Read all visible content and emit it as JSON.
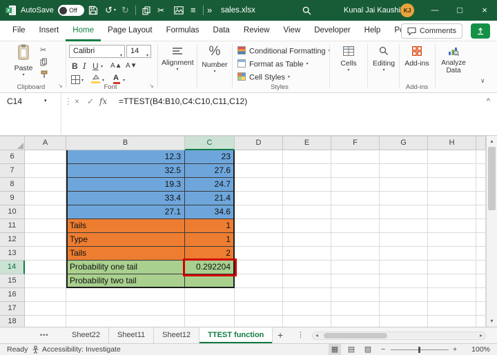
{
  "colors": {
    "titlebar_green": "#185C37",
    "excel_accent_green": "#107C41",
    "cell_fill_blue": "#6EA6DB",
    "cell_fill_orange": "#ED7D31",
    "cell_fill_green": "#A9D08E",
    "selection_border_red": "#D00000",
    "avatar_gold": "#E8A33D",
    "addins_icon_orange": "#D83B01",
    "share_button_green": "#159147"
  },
  "title_bar": {
    "autosave_label": "AutoSave",
    "autosave_state": "Off",
    "filename": "sales.xlsx",
    "user_name": "Kunal Jai Kaushik",
    "user_initials": "KJ"
  },
  "menu": {
    "tabs": [
      {
        "label": "File"
      },
      {
        "label": "Insert"
      },
      {
        "label": "Home",
        "active": true
      },
      {
        "label": "Page Layout"
      },
      {
        "label": "Formulas"
      },
      {
        "label": "Data"
      },
      {
        "label": "Review"
      },
      {
        "label": "View"
      },
      {
        "label": "Developer"
      },
      {
        "label": "Help"
      },
      {
        "label": "Power Pivot"
      }
    ],
    "comments_label": "Comments"
  },
  "ribbon": {
    "paste_label": "Paste",
    "clipboard_group_label": "Clipboard",
    "font_name": "Calibri",
    "font_size": "14",
    "font_group_label": "Font",
    "alignment_label": "Alignment",
    "number_label": "Number",
    "styles_items": [
      "Conditional Formatting",
      "Format as Table",
      "Cell Styles"
    ],
    "styles_group_label": "Styles",
    "cells_label": "Cells",
    "editing_label": "Editing",
    "addins_label": "Add-ins",
    "addins_group_label": "Add-ins",
    "analyze_data_label": "Analyze Data"
  },
  "formula_bar": {
    "name_box": "C14",
    "formula": "=TTEST(B4:B10,C4:C10,C11,C12)"
  },
  "sheet": {
    "columns": [
      "A",
      "B",
      "C",
      "D",
      "E",
      "F",
      "G",
      "H"
    ],
    "selected_column": "C",
    "selected_row": 14,
    "selected_cell": "C14",
    "rows": [
      {
        "row": 6,
        "fill": "blue",
        "cells": {
          "B": "12.3",
          "C": "23"
        }
      },
      {
        "row": 7,
        "fill": "blue",
        "cells": {
          "B": "32.5",
          "C": "27.6"
        }
      },
      {
        "row": 8,
        "fill": "blue",
        "cells": {
          "B": "19.3",
          "C": "24.7"
        }
      },
      {
        "row": 9,
        "fill": "blue",
        "cells": {
          "B": "33.4",
          "C": "21.4"
        }
      },
      {
        "row": 10,
        "fill": "blue",
        "cells": {
          "B": "27.1",
          "C": "34.6"
        }
      },
      {
        "row": 11,
        "fill": "orange",
        "cells": {
          "B": "Tails",
          "C": "1"
        }
      },
      {
        "row": 12,
        "fill": "orange",
        "cells": {
          "B": "Type",
          "C": "1"
        }
      },
      {
        "row": 13,
        "fill": "orange",
        "cells": {
          "B": "Tails",
          "C": "2"
        }
      },
      {
        "row": 14,
        "fill": "green",
        "cells": {
          "B": "Probability one tail",
          "C": "0.292204"
        }
      },
      {
        "row": 15,
        "fill": "green",
        "cells": {
          "B": "Probability two tail",
          "C": ""
        }
      },
      {
        "row": 16,
        "cells": {}
      },
      {
        "row": 17,
        "cells": {}
      },
      {
        "row": 18,
        "cells": {}
      }
    ]
  },
  "sheet_tabs": {
    "tabs": [
      {
        "label": "Sheet22"
      },
      {
        "label": "Sheet11"
      },
      {
        "label": "Sheet12"
      },
      {
        "label": "TTEST function",
        "active": true
      }
    ]
  },
  "status_bar": {
    "mode": "Ready",
    "accessibility": "Accessibility: Investigate",
    "zoom": "100%"
  },
  "icons": {
    "dropdown": "▾",
    "undo": "↺",
    "redo": "↻",
    "cut": "✂",
    "list": "≡",
    "more": "»",
    "close": "×",
    "check": "✓",
    "fx": "fx",
    "chevron_up": "^",
    "collapse_ribbon": "∨",
    "vdots": "⋮",
    "ellipsis": "•••",
    "plus": "+",
    "minus": "−",
    "percent": "%",
    "bold": "B",
    "italic": "I",
    "underline": "U",
    "grow_font": "A▲",
    "shrink_font": "A▼",
    "launcher": "↘",
    "minimize": "—",
    "maximize": "□",
    "window_close": "×",
    "scroll_left": "◂",
    "scroll_right": "▸",
    "scroll_up": "▴",
    "scroll_down": "▾",
    "view_normal": "▦",
    "view_layout": "▤",
    "view_break": "▨"
  }
}
